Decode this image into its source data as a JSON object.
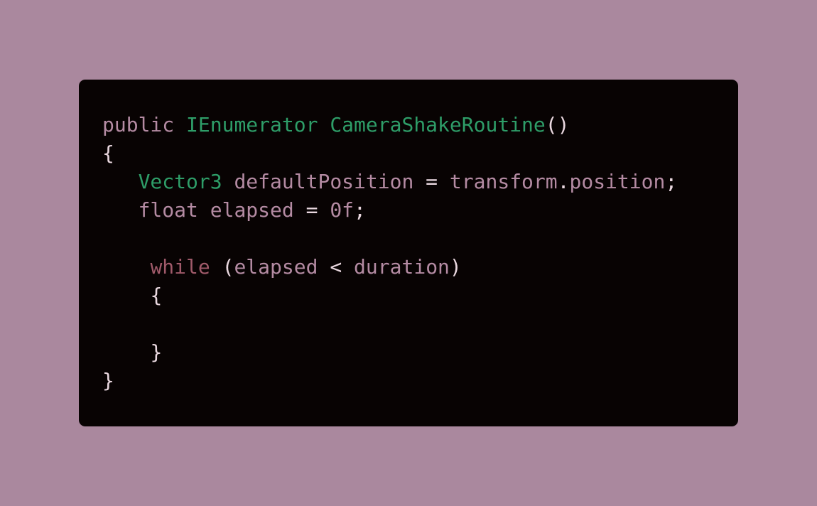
{
  "colors": {
    "background": "#aa889e",
    "card": "#080303",
    "keyword": "#b48ba3",
    "type": "#2e9d68",
    "control": "#a05a6a",
    "punctuation": "#ead8e0"
  },
  "code": {
    "lines": [
      {
        "tokens": [
          {
            "text": "public",
            "kind": "kw"
          },
          {
            "text": " ",
            "kind": "punc"
          },
          {
            "text": "IEnumerator",
            "kind": "type"
          },
          {
            "text": " ",
            "kind": "punc"
          },
          {
            "text": "CameraShakeRoutine",
            "kind": "fn"
          },
          {
            "text": "()",
            "kind": "punc"
          }
        ]
      },
      {
        "tokens": [
          {
            "text": "{",
            "kind": "punc"
          }
        ]
      },
      {
        "tokens": [
          {
            "text": "   ",
            "kind": "punc"
          },
          {
            "text": "Vector3",
            "kind": "type"
          },
          {
            "text": " ",
            "kind": "punc"
          },
          {
            "text": "defaultPosition",
            "kind": "id"
          },
          {
            "text": " = ",
            "kind": "op"
          },
          {
            "text": "transform",
            "kind": "id"
          },
          {
            "text": ".",
            "kind": "punc"
          },
          {
            "text": "position",
            "kind": "id"
          },
          {
            "text": ";",
            "kind": "punc"
          }
        ]
      },
      {
        "tokens": [
          {
            "text": "   ",
            "kind": "punc"
          },
          {
            "text": "float",
            "kind": "kw"
          },
          {
            "text": " ",
            "kind": "punc"
          },
          {
            "text": "elapsed",
            "kind": "id"
          },
          {
            "text": " = ",
            "kind": "op"
          },
          {
            "text": "0f",
            "kind": "num"
          },
          {
            "text": ";",
            "kind": "punc"
          }
        ]
      },
      {
        "tokens": []
      },
      {
        "tokens": [
          {
            "text": "    ",
            "kind": "punc"
          },
          {
            "text": "while",
            "kind": "ctrl"
          },
          {
            "text": " (",
            "kind": "punc"
          },
          {
            "text": "elapsed",
            "kind": "id"
          },
          {
            "text": " < ",
            "kind": "op"
          },
          {
            "text": "duration",
            "kind": "id"
          },
          {
            "text": ")",
            "kind": "punc"
          }
        ]
      },
      {
        "tokens": [
          {
            "text": "    ",
            "kind": "punc"
          },
          {
            "text": "{",
            "kind": "punc"
          }
        ]
      },
      {
        "tokens": []
      },
      {
        "tokens": [
          {
            "text": "    ",
            "kind": "punc"
          },
          {
            "text": "}",
            "kind": "punc"
          }
        ]
      },
      {
        "tokens": [
          {
            "text": "}",
            "kind": "punc"
          }
        ]
      }
    ]
  }
}
